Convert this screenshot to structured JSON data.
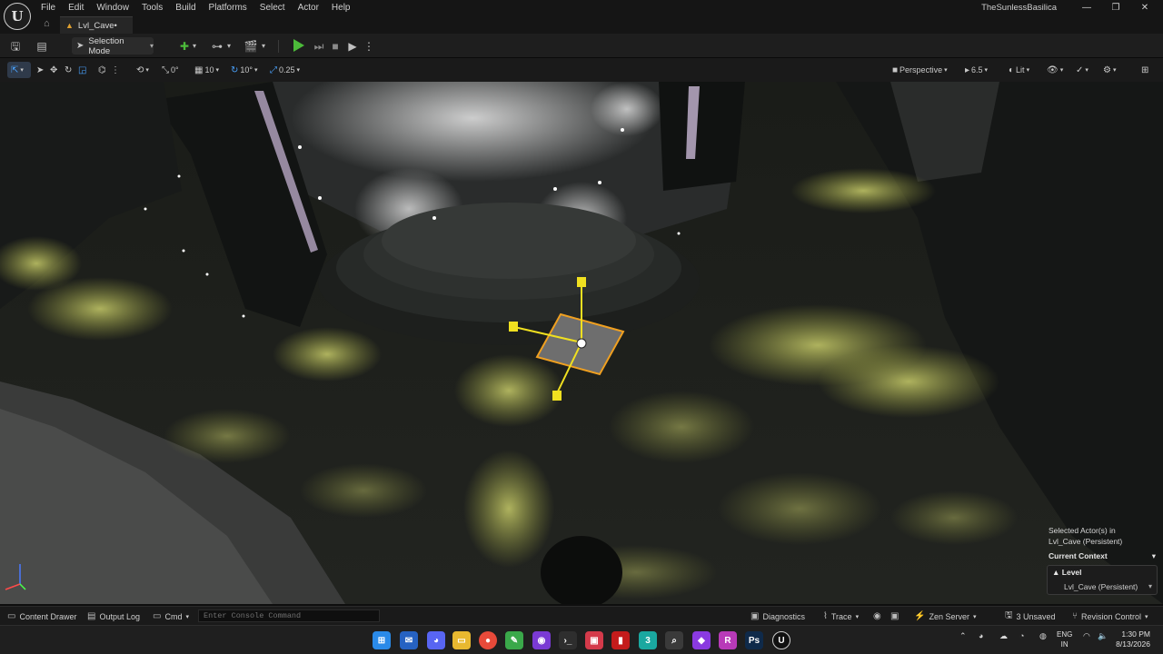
{
  "menubar": {
    "logo": "U",
    "items": [
      "File",
      "Edit",
      "Window",
      "Tools",
      "Build",
      "Platforms",
      "Select",
      "Actor",
      "Help"
    ],
    "project_name": "TheSunlessBasilica",
    "window_controls": [
      "—",
      "❐",
      "✕"
    ]
  },
  "tabs": {
    "level_tab_label": "Lvl_Cave•"
  },
  "toolbar": {
    "mode_label": "Selection Mode"
  },
  "viewport_toolbar": {
    "rotate_snap_value": "0°",
    "grid_snap_value": "10",
    "angle_snap_value": "10°",
    "scale_snap_value": "0.25",
    "view_mode": "Perspective",
    "camera_speed": "6.5",
    "lighting_mode": "Lit"
  },
  "overlay": {
    "selected_line1": "Selected Actor(s) in",
    "selected_line2": "Lvl_Cave (Persistent)",
    "current_context_label": "Current Context",
    "level_label": "Level",
    "level_value": "Lvl_Cave (Persistent)"
  },
  "statusbar": {
    "content_drawer": "Content Drawer",
    "output_log": "Output Log",
    "cmd": "Cmd",
    "console_placeholder": "Enter Console Command",
    "diagnostics": "Diagnostics",
    "trace": "Trace",
    "zen_server": "Zen Server",
    "unsaved": "3 Unsaved",
    "revision_control": "Revision Control"
  },
  "taskbar": {
    "lang_line1": "ENG",
    "lang_line2": "IN",
    "time": "1:30 PM",
    "date": "8/13/2026"
  },
  "colors": {
    "accent_blue": "#4aa3ff",
    "play_green": "#4cbb3a",
    "selection_yellow": "#f0e020",
    "selection_orange": "#f0a020",
    "grass": "#b8bd5a"
  }
}
